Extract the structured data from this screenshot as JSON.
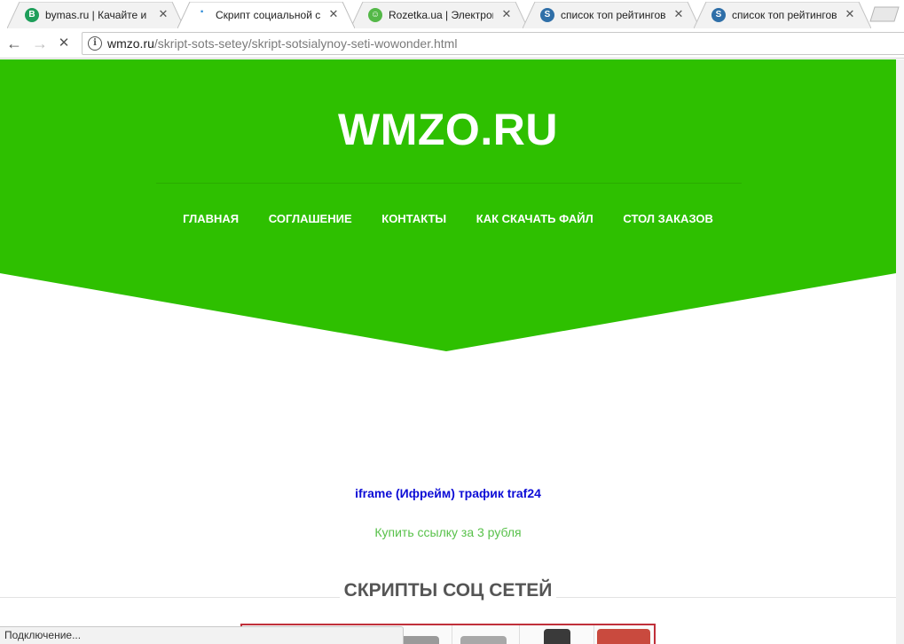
{
  "browser": {
    "tabs": [
      {
        "title": "bymas.ru | Качайте и пол",
        "favicon": "B",
        "favicon_color": "#1e9e5a",
        "active": false
      },
      {
        "title": "Скрипт социальной сети",
        "favicon": "",
        "favicon_color": "#2a8ad8",
        "active": true
      },
      {
        "title": "Rozetka.ua | Электроваф",
        "favicon": "☺",
        "favicon_color": "#54b848",
        "active": false
      },
      {
        "title": "список топ рейтингов к",
        "favicon": "S",
        "favicon_color": "#2f6fa8",
        "active": false
      },
      {
        "title": "список топ рейтингов к",
        "favicon": "S",
        "favicon_color": "#2f6fa8",
        "active": false
      }
    ],
    "close_glyph": "✕",
    "url_host": "wmzo.ru",
    "url_path": "/skript-sots-setey/skript-sotsialynoy-seti-wowonder.html",
    "info_glyph": "i",
    "back_glyph": "←",
    "forward_glyph": "→",
    "stop_glyph": "✕",
    "status_text": "Подключение..."
  },
  "site": {
    "logo": "WMZO.RU",
    "menu": [
      "ГЛАВНАЯ",
      "СОГЛАШЕНИЕ",
      "КОНТАКТЫ",
      "КАК СКАЧАТЬ ФАЙЛ",
      "СТОЛ ЗАКАЗОВ"
    ],
    "promo_link": "iframe (Ифрейм) трафик traf24",
    "buy_link": "Купить ссылку за 3 рубля",
    "section_title": "СКРИПТЫ СОЦ СЕТЕЙ"
  },
  "colors": {
    "brand_green": "#2ec000",
    "promo_blue": "#0d0dd6",
    "buy_green": "#58c14a",
    "banner_border": "#c0303a"
  }
}
